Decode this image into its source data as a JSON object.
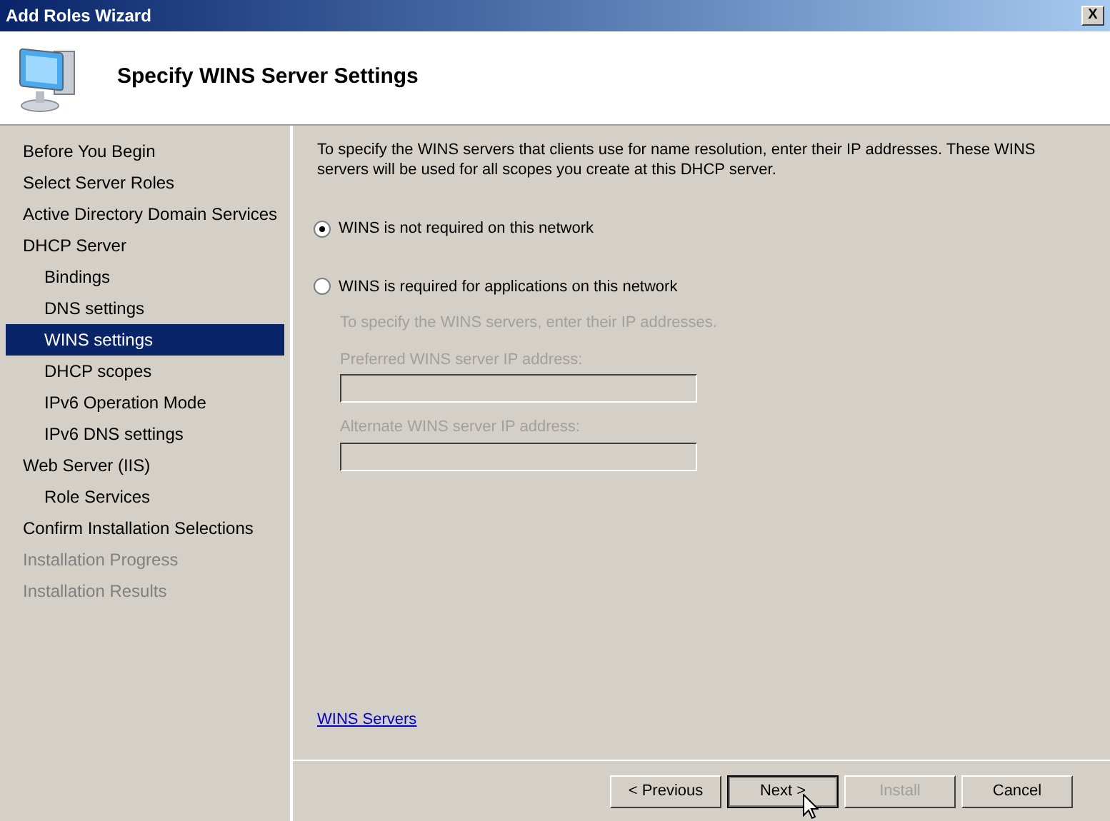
{
  "window": {
    "title": "Add Roles Wizard",
    "close": "X"
  },
  "header": {
    "title": "Specify WINS Server Settings"
  },
  "sidebar": {
    "items": [
      {
        "label": "Before You Begin",
        "selected": false,
        "disabled": false
      },
      {
        "label": "Select Server Roles",
        "selected": false,
        "disabled": false
      },
      {
        "label": "Active Directory Domain Services",
        "selected": false,
        "disabled": false
      },
      {
        "label": "DHCP Server",
        "selected": false,
        "disabled": false,
        "children": [
          {
            "label": "Bindings",
            "selected": false,
            "disabled": false
          },
          {
            "label": "DNS settings",
            "selected": false,
            "disabled": false
          },
          {
            "label": "WINS settings",
            "selected": true,
            "disabled": false
          },
          {
            "label": "DHCP scopes",
            "selected": false,
            "disabled": false
          },
          {
            "label": "IPv6 Operation Mode",
            "selected": false,
            "disabled": false
          },
          {
            "label": "IPv6 DNS settings",
            "selected": false,
            "disabled": false
          }
        ]
      },
      {
        "label": "Web Server (IIS)",
        "selected": false,
        "disabled": false,
        "children": [
          {
            "label": "Role Services",
            "selected": false,
            "disabled": false
          }
        ]
      },
      {
        "label": "Confirm Installation Selections",
        "selected": false,
        "disabled": false
      },
      {
        "label": "Installation Progress",
        "selected": false,
        "disabled": true
      },
      {
        "label": "Installation Results",
        "selected": false,
        "disabled": true
      }
    ]
  },
  "content": {
    "intro": "To specify the WINS servers that clients use for name resolution, enter their IP addresses. These WINS servers will be used for all scopes you create at this DHCP server.",
    "options": [
      {
        "label": "WINS is not required on this network",
        "selected": true
      },
      {
        "label": "WINS is required for applications on this network",
        "selected": false
      }
    ],
    "hint": "To specify the WINS servers, enter their IP addresses.",
    "fields": [
      {
        "label": "Preferred WINS server IP address:",
        "disabled": true
      },
      {
        "label": "Alternate WINS server IP address:",
        "disabled": true
      }
    ],
    "link": "WINS Servers"
  },
  "buttons": [
    {
      "label": "< Previous",
      "disabled": false,
      "default": false
    },
    {
      "label": "Next >",
      "disabled": false,
      "default": true
    },
    {
      "label": "Install",
      "disabled": true,
      "default": false
    },
    {
      "label": "Cancel",
      "disabled": false,
      "default": false
    }
  ]
}
